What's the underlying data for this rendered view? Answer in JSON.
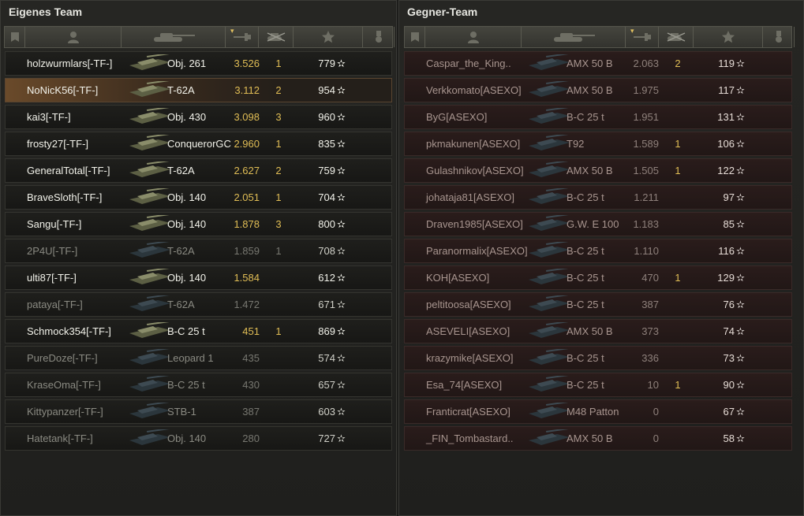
{
  "left": {
    "title": "Eigenes Team",
    "rows": [
      {
        "name": "holzwurmlars[-TF-]",
        "tank": "Obj. 261",
        "rating": "3.526",
        "kills": "1",
        "xp": "779",
        "state": "alive"
      },
      {
        "name": "NoNicK56[-TF-]",
        "tank": "T-62A",
        "rating": "3.112",
        "kills": "2",
        "xp": "954",
        "state": "me"
      },
      {
        "name": "kai3[-TF-]",
        "tank": "Obj. 430",
        "rating": "3.098",
        "kills": "3",
        "xp": "960",
        "state": "alive"
      },
      {
        "name": "frosty27[-TF-]",
        "tank": "ConquerorGC",
        "rating": "2.960",
        "kills": "1",
        "xp": "835",
        "state": "alive"
      },
      {
        "name": "GeneralTotal[-TF-]",
        "tank": "T-62A",
        "rating": "2.627",
        "kills": "2",
        "xp": "759",
        "state": "alive"
      },
      {
        "name": "BraveSloth[-TF-]",
        "tank": "Obj. 140",
        "rating": "2.051",
        "kills": "1",
        "xp": "704",
        "state": "alive"
      },
      {
        "name": "Sangu[-TF-]",
        "tank": "Obj. 140",
        "rating": "1.878",
        "kills": "3",
        "xp": "800",
        "state": "alive"
      },
      {
        "name": "2P4U[-TF-]",
        "tank": "T-62A",
        "rating": "1.859",
        "kills": "1",
        "xp": "708",
        "state": "dead"
      },
      {
        "name": "ulti87[-TF-]",
        "tank": "Obj. 140",
        "rating": "1.584",
        "kills": "",
        "xp": "612",
        "state": "alive"
      },
      {
        "name": "pataya[-TF-]",
        "tank": "T-62A",
        "rating": "1.472",
        "kills": "",
        "xp": "671",
        "state": "dead"
      },
      {
        "name": "Schmock354[-TF-]",
        "tank": "B-C 25 t",
        "rating": "451",
        "kills": "1",
        "xp": "869",
        "state": "alive"
      },
      {
        "name": "PureDoze[-TF-]",
        "tank": "Leopard 1",
        "rating": "435",
        "kills": "",
        "xp": "574",
        "state": "dead"
      },
      {
        "name": "KraseOma[-TF-]",
        "tank": "B-C 25 t",
        "rating": "430",
        "kills": "",
        "xp": "657",
        "state": "dead"
      },
      {
        "name": "Kittypanzer[-TF-]",
        "tank": "STB-1",
        "rating": "387",
        "kills": "",
        "xp": "603",
        "state": "dead"
      },
      {
        "name": "Hatetank[-TF-]",
        "tank": "Obj. 140",
        "rating": "280",
        "kills": "",
        "xp": "727",
        "state": "dead"
      }
    ]
  },
  "right": {
    "title": "Gegner-Team",
    "rows": [
      {
        "name": "Caspar_the_King..",
        "tank": "AMX 50 B",
        "rating": "2.063",
        "kills": "2",
        "xp": "119"
      },
      {
        "name": "Verkkomato[ASEXO]",
        "tank": "AMX 50 B",
        "rating": "1.975",
        "kills": "",
        "xp": "117"
      },
      {
        "name": "ByG[ASEXO]",
        "tank": "B-C 25 t",
        "rating": "1.951",
        "kills": "",
        "xp": "131"
      },
      {
        "name": "pkmakunen[ASEXO]",
        "tank": "T92",
        "rating": "1.589",
        "kills": "1",
        "xp": "106"
      },
      {
        "name": "Gulashnikov[ASEXO]",
        "tank": "AMX 50 B",
        "rating": "1.505",
        "kills": "1",
        "xp": "122"
      },
      {
        "name": "johataja81[ASEXO]",
        "tank": "B-C 25 t",
        "rating": "1.211",
        "kills": "",
        "xp": "97"
      },
      {
        "name": "Draven1985[ASEXO]",
        "tank": "G.W. E 100",
        "rating": "1.183",
        "kills": "",
        "xp": "85"
      },
      {
        "name": "Paranormalix[ASEXO]",
        "tank": "B-C 25 t",
        "rating": "1.110",
        "kills": "",
        "xp": "116"
      },
      {
        "name": "KOH[ASEXO]",
        "tank": "B-C 25 t",
        "rating": "470",
        "kills": "1",
        "xp": "129"
      },
      {
        "name": "peltitoosa[ASEXO]",
        "tank": "B-C 25 t",
        "rating": "387",
        "kills": "",
        "xp": "76"
      },
      {
        "name": "ASEVELI[ASEXO]",
        "tank": "AMX 50 B",
        "rating": "373",
        "kills": "",
        "xp": "74"
      },
      {
        "name": "krazymike[ASEXO]",
        "tank": "B-C 25 t",
        "rating": "336",
        "kills": "",
        "xp": "73"
      },
      {
        "name": "Esa_74[ASEXO]",
        "tank": "B-C 25 t",
        "rating": "10",
        "kills": "1",
        "xp": "90"
      },
      {
        "name": "Franticrat[ASEXO]",
        "tank": "M48 Patton",
        "rating": "0",
        "kills": "",
        "xp": "67"
      },
      {
        "name": "_FIN_Tombastard..",
        "tank": "AMX 50 B",
        "rating": "0",
        "kills": "",
        "xp": "58"
      }
    ]
  },
  "star_glyph": "✫",
  "colors": {
    "accent": "#e0bd55",
    "enemy_row": "#2a1c1b",
    "own_row": "#1f1f1c"
  }
}
